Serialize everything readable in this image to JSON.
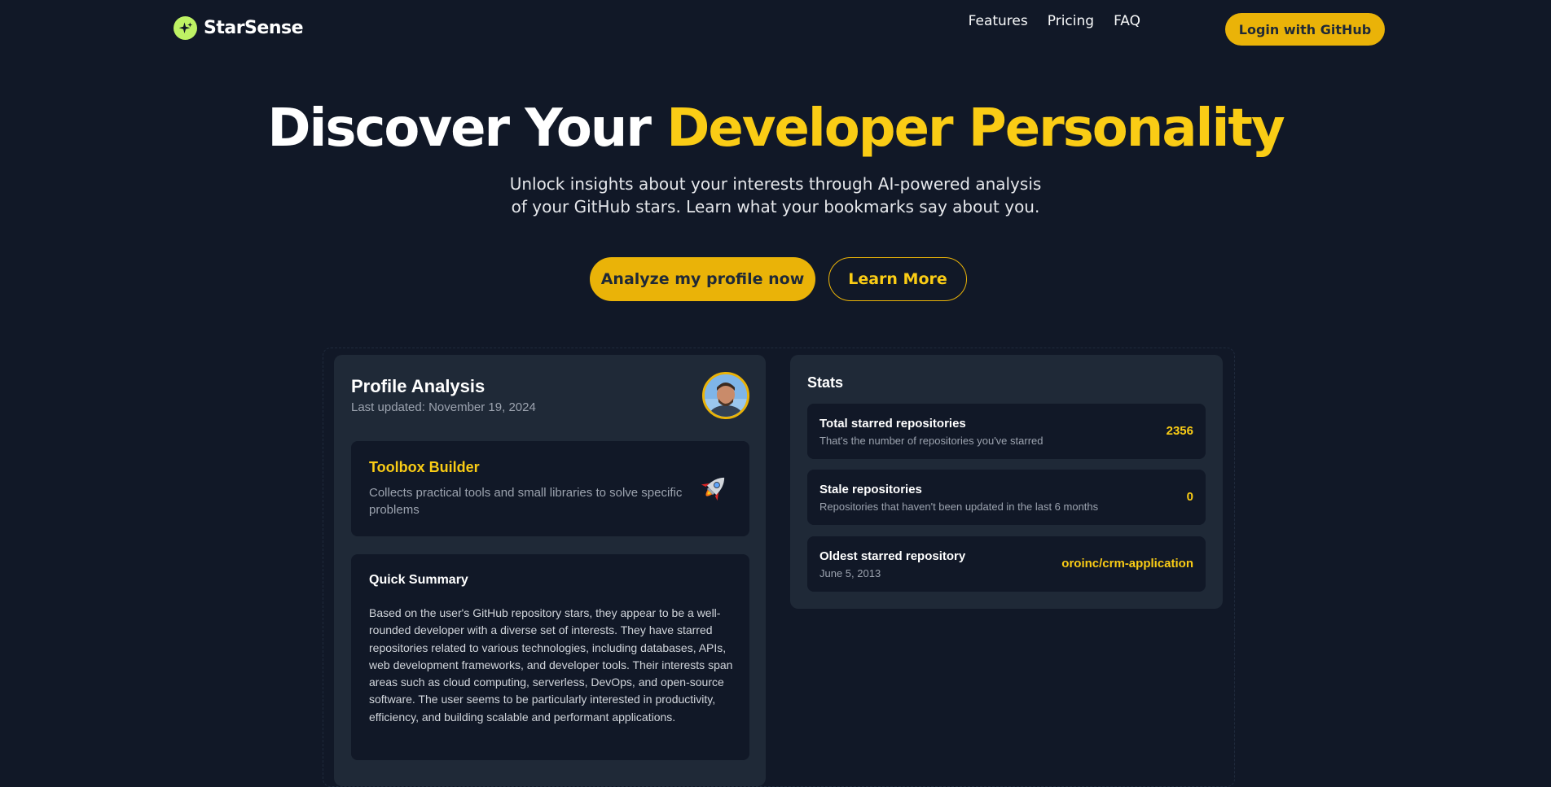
{
  "brand": {
    "name": "StarSense",
    "logo_icon": "sparkle-icon",
    "accent": "#eab308",
    "logo_color": "#bef264"
  },
  "nav": {
    "links": [
      "Features",
      "Pricing",
      "FAQ"
    ],
    "login_label": "Login with GitHub"
  },
  "hero": {
    "title_plain": "Discover Your ",
    "title_accent": "Developer Personality",
    "subtitle": "Unlock insights about your interests through AI-powered analysis of your GitHub stars. Learn what your bookmarks say about you.",
    "cta_primary": "Analyze my profile now",
    "cta_secondary": "Learn More"
  },
  "profile": {
    "title": "Profile Analysis",
    "updated": "Last updated: November 19, 2024",
    "persona": {
      "name": "Toolbox Builder",
      "description": "Collects practical tools and small libraries to solve specific problems",
      "icon": "rocket-icon"
    },
    "summary": {
      "title": "Quick Summary",
      "text": "Based on the user's GitHub repository stars, they appear to be a well-rounded developer with a diverse set of interests. They have starred repositories related to various technologies, including databases, APIs, web development frameworks, and developer tools. Their interests span areas such as cloud computing, serverless, DevOps, and open-source software. The user seems to be particularly interested in productivity, efficiency, and building scalable and performant applications."
    }
  },
  "stats": {
    "title": "Stats",
    "items": [
      {
        "label": "Total starred repositories",
        "description": "That's the number of repositories you've starred",
        "value": "2356"
      },
      {
        "label": "Stale repositories",
        "description": "Repositories that haven't been updated in the last 6 months",
        "value": "0"
      },
      {
        "label": "Oldest starred repository",
        "description": "June 5, 2013",
        "value": "oroinc/crm-application"
      }
    ]
  }
}
